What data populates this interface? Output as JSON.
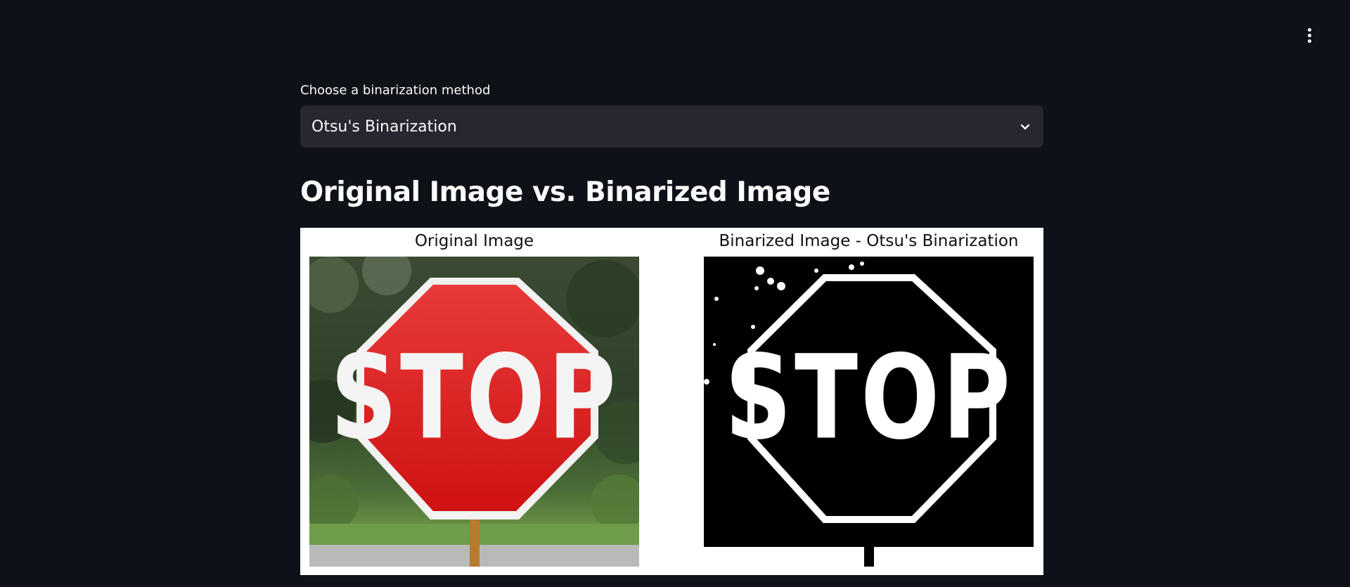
{
  "header": {
    "menu_icon": "more-vertical-icon"
  },
  "select": {
    "label": "Choose a binarization method",
    "value": "Otsu's Binarization",
    "icon": "chevron-down-icon"
  },
  "main": {
    "title": "Original Image vs. Binarized Image"
  },
  "figure": {
    "left_title": "Original Image",
    "right_title": "Binarized Image - Otsu's Binarization",
    "sign_text": "STOP"
  }
}
